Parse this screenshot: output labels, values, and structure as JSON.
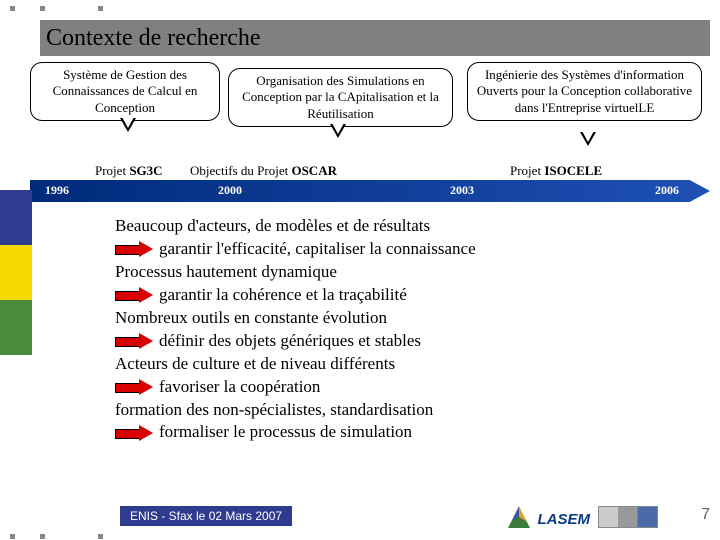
{
  "title": "Contexte de recherche",
  "callouts": {
    "c1": "Système de Gestion des Connaissances de Calcul en Conception",
    "c2": "Organisation des Simulations en Conception par la CApitalisation et la Réutilisation",
    "c3": "Ingénierie des Systèmes d'information Ouverts pour la Conception collaborative dans l'Entreprise virtuelLE"
  },
  "projects": {
    "p1": "Projet SG3C",
    "p2": "Objectifs du Projet OSCAR",
    "p3": "Projet ISOCELE"
  },
  "years": {
    "y1": "1996",
    "y2": "2000",
    "y3": "2003",
    "y4": "2006"
  },
  "body": {
    "l1": "Beaucoup d'acteurs, de modèles et de résultats",
    "l2": "garantir l'efficacité, capitaliser la connaissance",
    "l3": "Processus hautement dynamique",
    "l4": "garantir la cohérence et la traçabilité",
    "l5": "Nombreux outils en constante évolution",
    "l6": "définir des objets génériques et stables",
    "l7": "Acteurs de culture et de niveau différents",
    "l8": "favoriser la coopération",
    "l9": "formation des non-spécialistes, standardisation",
    "l10": "formaliser le processus de simulation"
  },
  "footer": {
    "venue": "ENIS - Sfax le 02 Mars 2007",
    "lab": "LASEM",
    "page": "7"
  }
}
